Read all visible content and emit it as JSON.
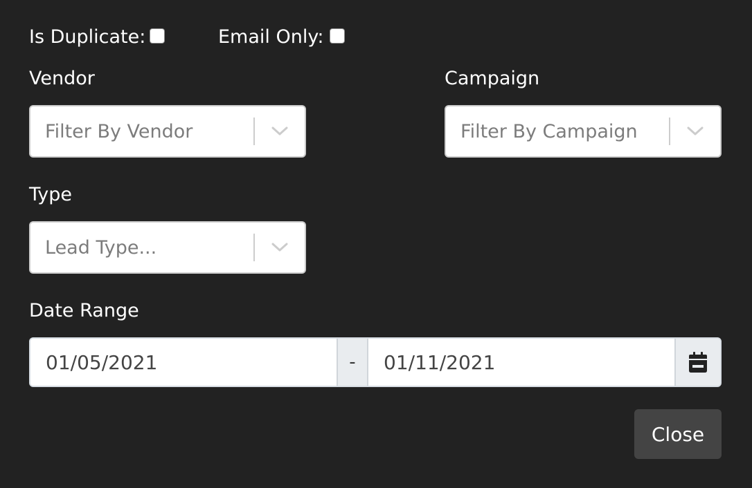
{
  "filters": {
    "is_duplicate": {
      "label": "Is Duplicate:",
      "checked": false
    },
    "email_only": {
      "label": "Email Only:",
      "checked": false
    },
    "vendor": {
      "label": "Vendor",
      "placeholder": "Filter By Vendor"
    },
    "campaign": {
      "label": "Campaign",
      "placeholder": "Filter By Campaign"
    },
    "type": {
      "label": "Type",
      "placeholder": "Lead Type..."
    },
    "date_range": {
      "label": "Date Range",
      "start": "01/05/2021",
      "separator": "-",
      "end": "01/11/2021",
      "icon": "calendar-icon"
    }
  },
  "actions": {
    "close_label": "Close"
  },
  "colors": {
    "background": "#222222",
    "button": "#444444",
    "input_addon": "#e9ecef"
  }
}
